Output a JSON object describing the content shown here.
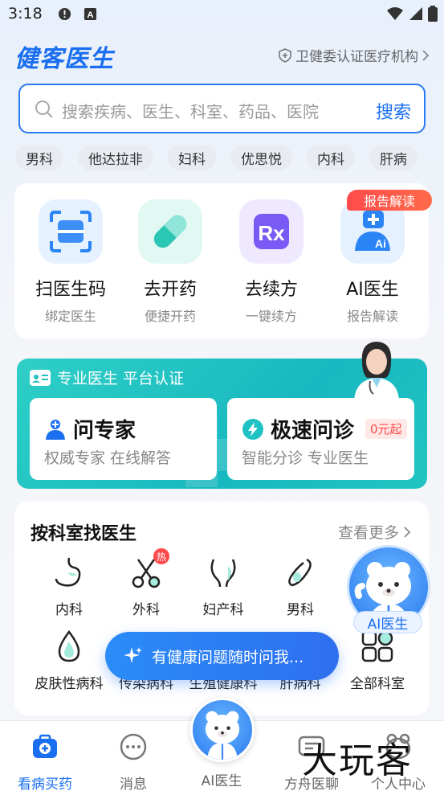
{
  "status_bar": {
    "time": "3:18"
  },
  "header": {
    "logo": "健客医生",
    "cert": "卫健委认证医疗机构"
  },
  "search": {
    "placeholder": "搜索疾病、医生、科室、药品、医院",
    "button": "搜索"
  },
  "chips": [
    "男科",
    "他达拉非",
    "妇科",
    "优思悦",
    "内科",
    "肝病"
  ],
  "services": [
    {
      "title": "扫医生码",
      "sub": "绑定医生",
      "icon": "scan-icon"
    },
    {
      "title": "去开药",
      "sub": "便捷开药",
      "icon": "pill-icon"
    },
    {
      "title": "去续方",
      "sub": "一键续方",
      "icon": "rx-icon"
    },
    {
      "title": "AI医生",
      "sub": "报告解读",
      "icon": "ai-doctor-icon",
      "tag": "报告解读"
    }
  ],
  "promo": {
    "header": "专业医生 平台认证",
    "cards": [
      {
        "title": "问专家",
        "sub": "权威专家 在线解答"
      },
      {
        "title": "极速问诊",
        "sub": "智能分诊 专业医生",
        "tag": "0元起"
      }
    ]
  },
  "departments": {
    "title": "按科室找医生",
    "more": "查看更多",
    "items": [
      {
        "label": "内科",
        "icon": "stomach-icon"
      },
      {
        "label": "外科",
        "icon": "scissors-icon",
        "badge": "热"
      },
      {
        "label": "妇产科",
        "icon": "uterus-icon"
      },
      {
        "label": "男科",
        "icon": "male-icon"
      },
      {
        "label": "皮肤性病科",
        "icon": "skin-drop-icon"
      },
      {
        "label": "传染病科",
        "icon": "virus-icon"
      },
      {
        "label": "生殖健康科",
        "icon": "reproductive-icon"
      },
      {
        "label": "肝病科",
        "icon": "liver-icon"
      },
      {
        "label": "全部科室",
        "icon": "grid-icon"
      }
    ]
  },
  "ai_float": {
    "label": "AI医生"
  },
  "chat_pill": {
    "text": "有健康问题随时问我..."
  },
  "bottom_nav": [
    {
      "label": "看病买药",
      "icon": "medkit-icon",
      "active": true
    },
    {
      "label": "消息",
      "icon": "message-icon",
      "active": false
    },
    {
      "label": "AI医生",
      "icon": "ai-bear-icon",
      "active": false
    },
    {
      "label": "方舟医聊",
      "icon": "chat-doctor-icon",
      "active": false
    },
    {
      "label": "个人中心",
      "icon": "profile-icon",
      "active": false
    }
  ],
  "watermark": "大玩客",
  "colors": {
    "brand": "#1a6ff0",
    "teal": "#1fc2c2",
    "hot": "#ff4a4a"
  }
}
